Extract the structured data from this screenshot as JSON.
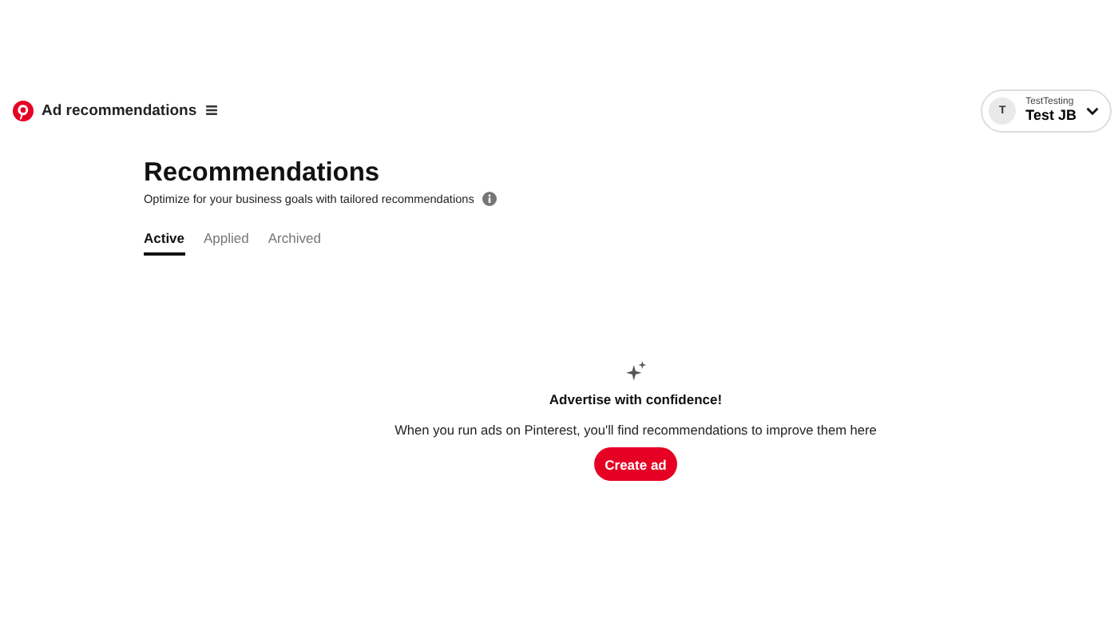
{
  "header": {
    "title": "Ad recommendations"
  },
  "account": {
    "avatar_letter": "T",
    "business": "TestTesting",
    "name": "Test JB"
  },
  "page": {
    "title": "Recommendations",
    "subtitle": "Optimize for your business goals with tailored recommendations"
  },
  "tabs": [
    {
      "label": "Active",
      "selected": true
    },
    {
      "label": "Applied",
      "selected": false
    },
    {
      "label": "Archived",
      "selected": false
    }
  ],
  "empty_state": {
    "title": "Advertise with confidence!",
    "message": "When you run ads on Pinterest, you'll find recommendations to improve them here",
    "button": "Create ad"
  }
}
